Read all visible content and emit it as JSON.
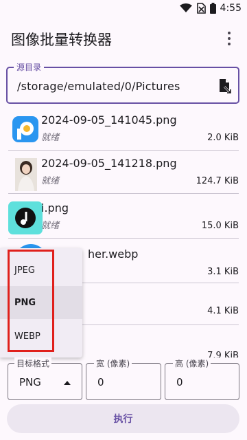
{
  "status_bar": {
    "time": "4:55"
  },
  "app_bar": {
    "title": "图像批量转换器"
  },
  "source": {
    "label": "源目录",
    "value": "/storage/emulated/0/Pictures"
  },
  "files": [
    {
      "name": "2024-09-05_141045.png",
      "status": "就绪",
      "size": "2.0 KiB"
    },
    {
      "name": "2024-09-05_141218.png",
      "status": "就绪",
      "size": "124.7 KiB"
    },
    {
      "name": "i.png",
      "status": "就绪",
      "size": "15.0 KiB"
    },
    {
      "name": "her.webp",
      "status": "",
      "size": "3.1 KiB"
    },
    {
      "name": "",
      "status": "",
      "size": "4.1 KiB"
    },
    {
      "name": "",
      "status": "",
      "size": "7.9 KiB"
    }
  ],
  "format_dropdown": {
    "options": [
      "JPEG",
      "PNG",
      "WEBP"
    ],
    "selected": "PNG"
  },
  "target_format": {
    "label": "目标格式",
    "value": "PNG"
  },
  "width": {
    "label": "宽 (像素)",
    "value": "0"
  },
  "height": {
    "label": "高 (像素)",
    "value": "0"
  },
  "execute": {
    "label": "执行"
  },
  "colors": {
    "primary": "#6750a4",
    "highlight": "#e0201c"
  }
}
